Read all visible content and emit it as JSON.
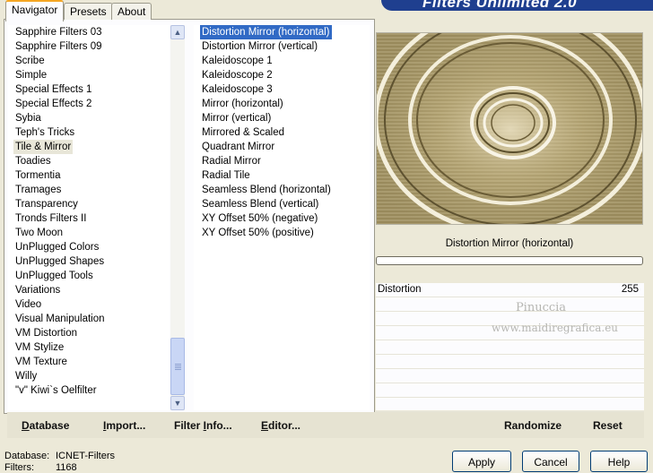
{
  "tabs": [
    {
      "label": "Navigator",
      "active": true
    },
    {
      "label": "Presets",
      "active": false
    },
    {
      "label": "About",
      "active": false
    }
  ],
  "title_banner": "Filters Unlimited 2.0",
  "categories": [
    {
      "label": "Sapphire Filters 03",
      "selected": false
    },
    {
      "label": "Sapphire Filters 09",
      "selected": false
    },
    {
      "label": "Scribe",
      "selected": false
    },
    {
      "label": "Simple",
      "selected": false
    },
    {
      "label": "Special Effects 1",
      "selected": false
    },
    {
      "label": "Special Effects 2",
      "selected": false
    },
    {
      "label": "Sybia",
      "selected": false
    },
    {
      "label": "Teph's Tricks",
      "selected": false
    },
    {
      "label": "Tile & Mirror",
      "selected": true
    },
    {
      "label": "Toadies",
      "selected": false
    },
    {
      "label": "Tormentia",
      "selected": false
    },
    {
      "label": "Tramages",
      "selected": false
    },
    {
      "label": "Transparency",
      "selected": false
    },
    {
      "label": "Tronds Filters II",
      "selected": false
    },
    {
      "label": "Two Moon",
      "selected": false
    },
    {
      "label": "UnPlugged Colors",
      "selected": false
    },
    {
      "label": "UnPlugged Shapes",
      "selected": false
    },
    {
      "label": "UnPlugged Tools",
      "selected": false
    },
    {
      "label": "Variations",
      "selected": false
    },
    {
      "label": "Video",
      "selected": false
    },
    {
      "label": "Visual Manipulation",
      "selected": false
    },
    {
      "label": "VM Distortion",
      "selected": false
    },
    {
      "label": "VM Stylize",
      "selected": false
    },
    {
      "label": "VM Texture",
      "selected": false
    },
    {
      "label": "Willy",
      "selected": false
    },
    {
      "label": "\"v\" Kiwi`s Oelfilter",
      "selected": false
    }
  ],
  "filters": [
    {
      "label": "Distortion Mirror (horizontal)",
      "selected": true
    },
    {
      "label": "Distortion Mirror (vertical)",
      "selected": false
    },
    {
      "label": "Kaleidoscope 1",
      "selected": false
    },
    {
      "label": "Kaleidoscope 2",
      "selected": false
    },
    {
      "label": "Kaleidoscope 3",
      "selected": false
    },
    {
      "label": "Mirror (horizontal)",
      "selected": false
    },
    {
      "label": "Mirror (vertical)",
      "selected": false
    },
    {
      "label": "Mirrored & Scaled",
      "selected": false
    },
    {
      "label": "Quadrant Mirror",
      "selected": false
    },
    {
      "label": "Radial Mirror",
      "selected": false
    },
    {
      "label": "Radial Tile",
      "selected": false
    },
    {
      "label": "Seamless Blend (horizontal)",
      "selected": false
    },
    {
      "label": "Seamless Blend (vertical)",
      "selected": false
    },
    {
      "label": "XY Offset 50% (negative)",
      "selected": false
    },
    {
      "label": "XY Offset 50% (positive)",
      "selected": false
    }
  ],
  "preview": {
    "caption": "Distortion Mirror (horizontal)",
    "progress_fraction": 0
  },
  "parameters": [
    {
      "label": "Distortion",
      "value": "255"
    }
  ],
  "watermark": {
    "line1": "Pinuccia",
    "line2": "www.maidiregrafica.eu"
  },
  "toolbar": {
    "database": {
      "u": "D",
      "rest": "atabase"
    },
    "import": {
      "pre": "",
      "u": "I",
      "rest": "mport..."
    },
    "filter_info": {
      "pre": "Filter ",
      "u": "I",
      "rest": "nfo..."
    },
    "editor": {
      "pre": "",
      "u": "E",
      "rest": "ditor..."
    },
    "randomize": "Randomize",
    "reset": "Reset"
  },
  "status": {
    "database_label": "Database:",
    "database_value": "ICNET-Filters",
    "filters_label": "Filters:",
    "filters_value": "1168"
  },
  "buttons": {
    "apply": "Apply",
    "cancel": "Cancel",
    "help": "Help"
  },
  "colors": {
    "window_bg": "#ece9d8",
    "selection_blue": "#316ac5",
    "banner_blue": "#1f3f8f",
    "tab_accent": "#f5a623",
    "preview_tone": "#a89868"
  }
}
